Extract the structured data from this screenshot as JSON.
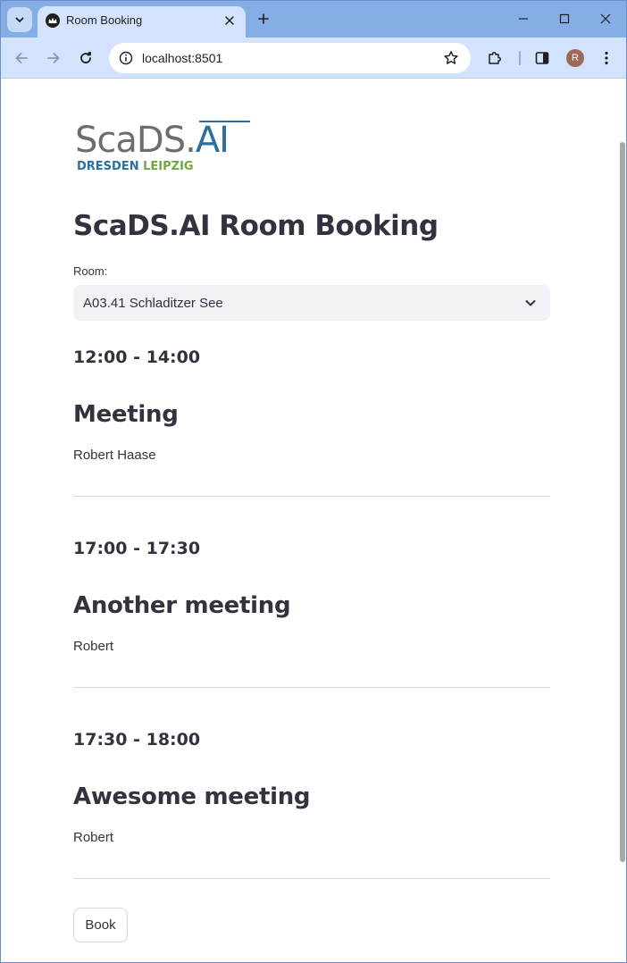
{
  "browser": {
    "tab_title": "Room Booking",
    "url": "localhost:8501",
    "profile_initial": "R"
  },
  "logo": {
    "main_left": "ScaDS.",
    "main_right": "AI",
    "sub_left": "DRESDEN",
    "sub_right": "LEIPZIG"
  },
  "page": {
    "title": "ScaDS.AI Room Booking",
    "room_label": "Room:",
    "room_selected": "A03.41 Schladitzer See",
    "book_label": "Book"
  },
  "bookings": [
    {
      "time": "12:00 - 14:00",
      "title": "Meeting",
      "person": "Robert Haase"
    },
    {
      "time": "17:00 - 17:30",
      "title": "Another meeting",
      "person": "Robert"
    },
    {
      "time": "17:30 - 18:00",
      "title": "Awesome meeting",
      "person": "Robert"
    }
  ],
  "colors": {
    "text": "#31333f",
    "select_bg": "#f0f2f6",
    "brand_blue": "#2b6f9e",
    "brand_green": "#6fa83e",
    "brand_grey": "#6b6d70",
    "tab_strip": "#86aee6",
    "toolbar": "#d3e3fd"
  }
}
